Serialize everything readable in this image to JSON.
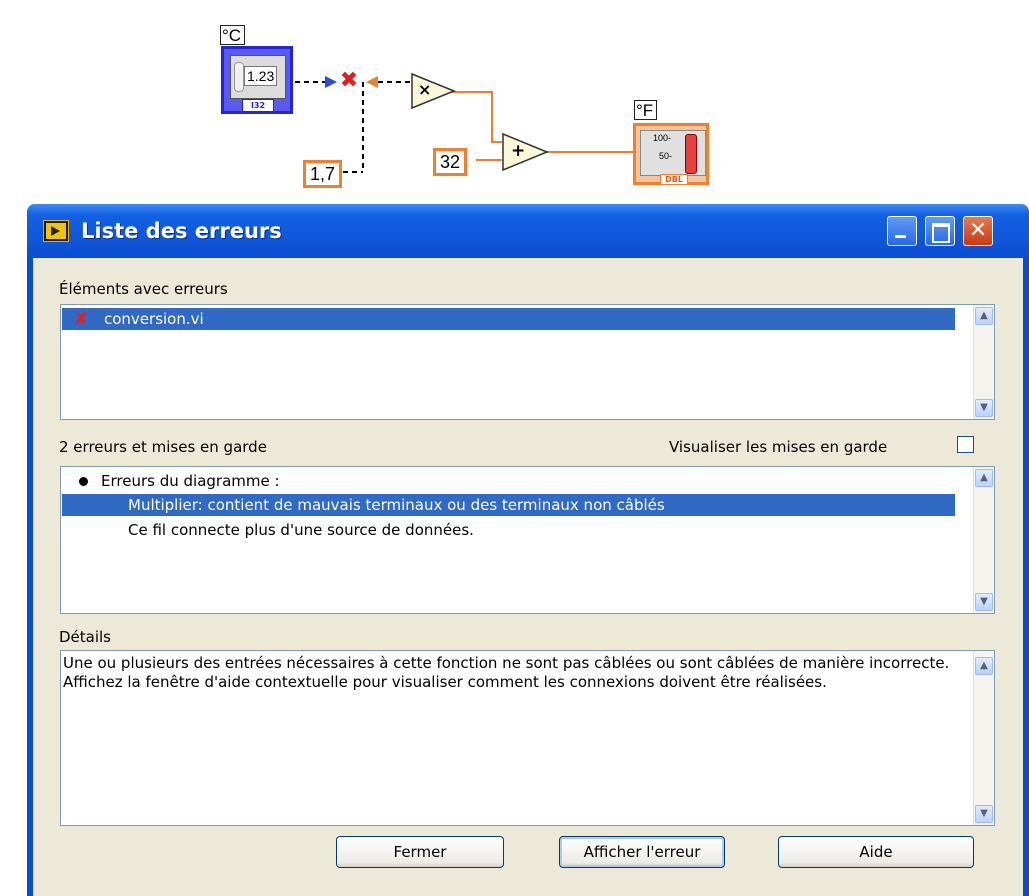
{
  "diagram": {
    "celsius_label": "°C",
    "fahrenheit_label": "°F",
    "control_value": "1.23",
    "control_type": "I32",
    "constant_factor": "1,7",
    "constant_offset": "32",
    "indicator_tick_high": "100-",
    "indicator_tick_mid": "50-",
    "indicator_type": "DBL",
    "multiply_symbol": "×",
    "add_symbol": "+"
  },
  "window": {
    "title": "Liste des erreurs",
    "close_glyph": "✕"
  },
  "items_section": {
    "label": "Éléments avec erreurs",
    "items": [
      {
        "name": "conversion.vi",
        "selected": true
      }
    ]
  },
  "errors_section": {
    "count_label": "2 erreurs et mises en garde",
    "show_warnings_label": "Visualiser les mises en garde",
    "show_warnings_checked": false,
    "category": "Erreurs du diagramme :",
    "errors": [
      {
        "text": "Multiplier: contient de mauvais terminaux ou des terminaux non câblés",
        "selected": true
      },
      {
        "text": "Ce fil connecte plus d'une source de données.",
        "selected": false
      }
    ]
  },
  "details_section": {
    "label": "Détails",
    "text": "Une ou plusieurs des entrées nécessaires à cette fonction ne sont pas câblées ou sont câblées de manière incorrecte. Affichez la fenêtre d'aide contextuelle pour visualiser comment les connexions doivent être réalisées."
  },
  "buttons": {
    "close": "Fermer",
    "show_error": "Afficher l'erreur",
    "help": "Aide"
  },
  "colors": {
    "selection": "#316ac5",
    "titlebar": "#0a4ccf",
    "dialog_face": "#ece9d8",
    "wire_orange": "#f08030",
    "error_red": "#e02020"
  }
}
